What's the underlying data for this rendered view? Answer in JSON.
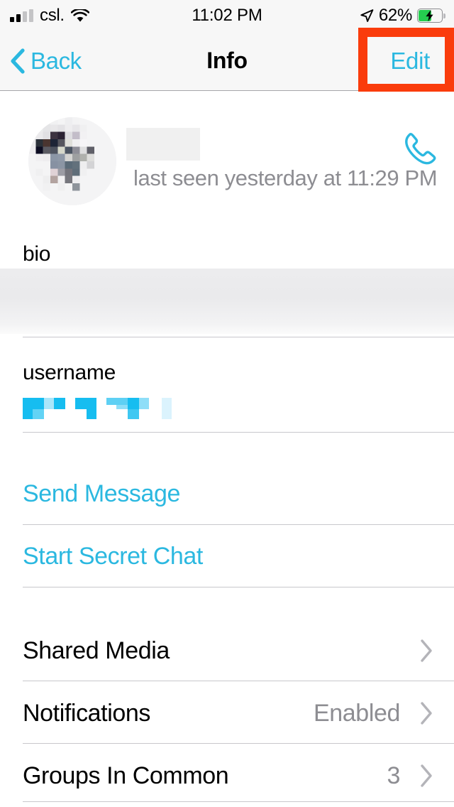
{
  "status_bar": {
    "carrier": "csl.",
    "time": "11:02 PM",
    "battery_percent": "62%",
    "battery_level": 62,
    "charging": true,
    "signal_bars_filled": 2,
    "signal_bars_total": 4,
    "wifi_icon": "wifi-icon",
    "location_icon": "location-arrow-icon",
    "battery_icon": "battery-charging-icon"
  },
  "navbar": {
    "back_label": "Back",
    "back_icon": "chevron-left-icon",
    "title": "Info",
    "edit_label": "Edit"
  },
  "annotation": {
    "highlight_color": "#fa3c0c",
    "target": "Edit"
  },
  "contact": {
    "avatar_icon": "avatar-image",
    "name": "",
    "name_redacted": true,
    "last_seen": "last seen yesterday at 11:29 PM",
    "call_icon": "phone-call-icon"
  },
  "fields": {
    "bio_label": "bio",
    "bio_value": "",
    "bio_redacted": true,
    "username_label": "username",
    "username_value": "",
    "username_redacted": true
  },
  "actions": [
    {
      "label": "Send Message",
      "name": "send-message-button"
    },
    {
      "label": "Start Secret Chat",
      "name": "start-secret-chat-button"
    }
  ],
  "rows": [
    {
      "title": "Shared Media",
      "value": "",
      "chevron": true
    },
    {
      "title": "Notifications",
      "value": "Enabled",
      "chevron": true
    },
    {
      "title": "Groups In Common",
      "value": "3",
      "chevron": true
    }
  ],
  "colors": {
    "accent": "#2bb8e0",
    "highlight": "#fa3c0c",
    "secondary_text": "#8d8d92",
    "separator": "#c8c7cc",
    "chrome_bg": "#f7f7f7",
    "battery_green": "#25cd4f"
  }
}
